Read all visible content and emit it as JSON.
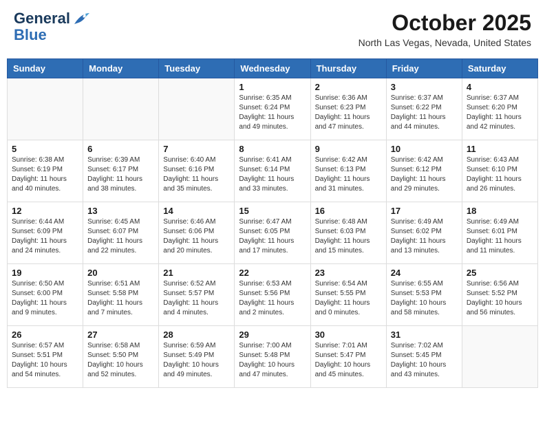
{
  "header": {
    "logo_line1": "General",
    "logo_line2": "Blue",
    "month": "October 2025",
    "location": "North Las Vegas, Nevada, United States"
  },
  "days_of_week": [
    "Sunday",
    "Monday",
    "Tuesday",
    "Wednesday",
    "Thursday",
    "Friday",
    "Saturday"
  ],
  "weeks": [
    [
      {
        "num": "",
        "info": ""
      },
      {
        "num": "",
        "info": ""
      },
      {
        "num": "",
        "info": ""
      },
      {
        "num": "1",
        "info": "Sunrise: 6:35 AM\nSunset: 6:24 PM\nDaylight: 11 hours\nand 49 minutes."
      },
      {
        "num": "2",
        "info": "Sunrise: 6:36 AM\nSunset: 6:23 PM\nDaylight: 11 hours\nand 47 minutes."
      },
      {
        "num": "3",
        "info": "Sunrise: 6:37 AM\nSunset: 6:22 PM\nDaylight: 11 hours\nand 44 minutes."
      },
      {
        "num": "4",
        "info": "Sunrise: 6:37 AM\nSunset: 6:20 PM\nDaylight: 11 hours\nand 42 minutes."
      }
    ],
    [
      {
        "num": "5",
        "info": "Sunrise: 6:38 AM\nSunset: 6:19 PM\nDaylight: 11 hours\nand 40 minutes."
      },
      {
        "num": "6",
        "info": "Sunrise: 6:39 AM\nSunset: 6:17 PM\nDaylight: 11 hours\nand 38 minutes."
      },
      {
        "num": "7",
        "info": "Sunrise: 6:40 AM\nSunset: 6:16 PM\nDaylight: 11 hours\nand 35 minutes."
      },
      {
        "num": "8",
        "info": "Sunrise: 6:41 AM\nSunset: 6:14 PM\nDaylight: 11 hours\nand 33 minutes."
      },
      {
        "num": "9",
        "info": "Sunrise: 6:42 AM\nSunset: 6:13 PM\nDaylight: 11 hours\nand 31 minutes."
      },
      {
        "num": "10",
        "info": "Sunrise: 6:42 AM\nSunset: 6:12 PM\nDaylight: 11 hours\nand 29 minutes."
      },
      {
        "num": "11",
        "info": "Sunrise: 6:43 AM\nSunset: 6:10 PM\nDaylight: 11 hours\nand 26 minutes."
      }
    ],
    [
      {
        "num": "12",
        "info": "Sunrise: 6:44 AM\nSunset: 6:09 PM\nDaylight: 11 hours\nand 24 minutes."
      },
      {
        "num": "13",
        "info": "Sunrise: 6:45 AM\nSunset: 6:07 PM\nDaylight: 11 hours\nand 22 minutes."
      },
      {
        "num": "14",
        "info": "Sunrise: 6:46 AM\nSunset: 6:06 PM\nDaylight: 11 hours\nand 20 minutes."
      },
      {
        "num": "15",
        "info": "Sunrise: 6:47 AM\nSunset: 6:05 PM\nDaylight: 11 hours\nand 17 minutes."
      },
      {
        "num": "16",
        "info": "Sunrise: 6:48 AM\nSunset: 6:03 PM\nDaylight: 11 hours\nand 15 minutes."
      },
      {
        "num": "17",
        "info": "Sunrise: 6:49 AM\nSunset: 6:02 PM\nDaylight: 11 hours\nand 13 minutes."
      },
      {
        "num": "18",
        "info": "Sunrise: 6:49 AM\nSunset: 6:01 PM\nDaylight: 11 hours\nand 11 minutes."
      }
    ],
    [
      {
        "num": "19",
        "info": "Sunrise: 6:50 AM\nSunset: 6:00 PM\nDaylight: 11 hours\nand 9 minutes."
      },
      {
        "num": "20",
        "info": "Sunrise: 6:51 AM\nSunset: 5:58 PM\nDaylight: 11 hours\nand 7 minutes."
      },
      {
        "num": "21",
        "info": "Sunrise: 6:52 AM\nSunset: 5:57 PM\nDaylight: 11 hours\nand 4 minutes."
      },
      {
        "num": "22",
        "info": "Sunrise: 6:53 AM\nSunset: 5:56 PM\nDaylight: 11 hours\nand 2 minutes."
      },
      {
        "num": "23",
        "info": "Sunrise: 6:54 AM\nSunset: 5:55 PM\nDaylight: 11 hours\nand 0 minutes."
      },
      {
        "num": "24",
        "info": "Sunrise: 6:55 AM\nSunset: 5:53 PM\nDaylight: 10 hours\nand 58 minutes."
      },
      {
        "num": "25",
        "info": "Sunrise: 6:56 AM\nSunset: 5:52 PM\nDaylight: 10 hours\nand 56 minutes."
      }
    ],
    [
      {
        "num": "26",
        "info": "Sunrise: 6:57 AM\nSunset: 5:51 PM\nDaylight: 10 hours\nand 54 minutes."
      },
      {
        "num": "27",
        "info": "Sunrise: 6:58 AM\nSunset: 5:50 PM\nDaylight: 10 hours\nand 52 minutes."
      },
      {
        "num": "28",
        "info": "Sunrise: 6:59 AM\nSunset: 5:49 PM\nDaylight: 10 hours\nand 49 minutes."
      },
      {
        "num": "29",
        "info": "Sunrise: 7:00 AM\nSunset: 5:48 PM\nDaylight: 10 hours\nand 47 minutes."
      },
      {
        "num": "30",
        "info": "Sunrise: 7:01 AM\nSunset: 5:47 PM\nDaylight: 10 hours\nand 45 minutes."
      },
      {
        "num": "31",
        "info": "Sunrise: 7:02 AM\nSunset: 5:45 PM\nDaylight: 10 hours\nand 43 minutes."
      },
      {
        "num": "",
        "info": ""
      }
    ]
  ]
}
